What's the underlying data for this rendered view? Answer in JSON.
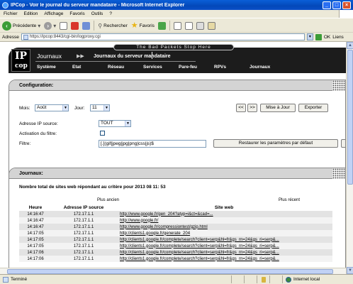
{
  "window": {
    "title": "IPCop - Voir le journal du serveur mandataire - Microsoft Internet Explorer",
    "min_label": "_",
    "max_label": "□",
    "close_label": "×"
  },
  "menu": [
    "Fichier",
    "Edition",
    "Affichage",
    "Favoris",
    "Outils",
    "?"
  ],
  "toolbar": {
    "back_label": "Précédente",
    "search_label": "Rechercher",
    "favorites_label": "Favoris"
  },
  "address": {
    "label": "Adresse",
    "url": "https://ipcop:8443/cgi-bin/logproxy.cgi",
    "go_label": "OK",
    "links_label": "Liens"
  },
  "header": {
    "tagline": "The Bad Packets Stop Here",
    "logo_top": "IP",
    "logo_bottom": "cop",
    "section": "Journaux",
    "subsection": "Journaux du serveur mandataire",
    "nav": [
      "Système",
      "Etat",
      "Réseau",
      "Services",
      "Pare-feu",
      "RPVs",
      "Journaux"
    ]
  },
  "config": {
    "title": "Configuration:",
    "month_label": "Mois:",
    "month_value": "Août",
    "day_label": "Jour:",
    "day_value": "11",
    "prev_label": "<<",
    "next_label": ">>",
    "update_label": "Mise à Jour",
    "export_label": "Exporter",
    "source_label": "Adresse IP source:",
    "source_value": "TOUT",
    "filter_active_label": "Activation du filtre:",
    "filter_label": "Filtre:",
    "filter_value": "[.](gif|jpeg|jpg|png|css|js)$",
    "restore_label": "Restaurer les paramètres par défaut"
  },
  "journal": {
    "title": "Journaux:",
    "summary": "Nombre total de sites web répondant au critère pour 2013 08 11: 53",
    "older_label": "Plus ancien",
    "newer_label": "Plus récent",
    "columns": [
      "Heure",
      "Adresse IP source",
      "Site web"
    ],
    "rows": [
      {
        "time": "14:16:47",
        "ip": "172.17.1.1",
        "url": "http://www.google.fr/gen_204?atyp=i&ct=&cad=..."
      },
      {
        "time": "14:16:47",
        "ip": "172.17.1.1",
        "url": "http://www.google.fr/"
      },
      {
        "time": "14:16:47",
        "ip": "172.17.1.1",
        "url": "http://www.google.fr/compressiontest/gzip.html"
      },
      {
        "time": "14:17:05",
        "ip": "172.17.1.1",
        "url": "http://clients1.google.fr/generate_204"
      },
      {
        "time": "14:17:05",
        "ip": "172.17.1.1",
        "url": "http://clients1.google.fr/complete/search?client=serp&hl=fr&gs_rn=24&gs_ri=serp&..."
      },
      {
        "time": "14:17:05",
        "ip": "172.17.1.1",
        "url": "http://clients1.google.fr/complete/search?client=serp&hl=fr&gs_rn=24&gs_ri=serp&..."
      },
      {
        "time": "14:17:06",
        "ip": "172.17.1.1",
        "url": "http://clients1.google.fr/complete/search?client=serp&hl=fr&gs_rn=24&gs_ri=serp&..."
      },
      {
        "time": "14:17:06",
        "ip": "172.17.1.1",
        "url": "http://clients1.google.fr/complete/search?client=serp&hl=fr&gs_rn=24&gs_ri=serp&..."
      }
    ]
  },
  "status": {
    "text": "Terminé",
    "zone": "Internet local"
  }
}
